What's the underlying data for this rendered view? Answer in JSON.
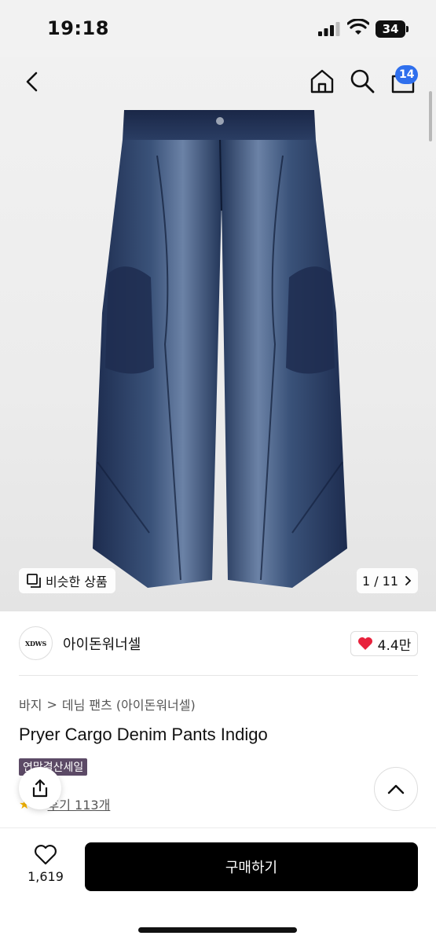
{
  "status_bar": {
    "time": "19:18",
    "battery": "34"
  },
  "header": {
    "cart_count": "14"
  },
  "gallery": {
    "similar_label": "비슷한 상품",
    "page_indicator": "1 / 11"
  },
  "brand": {
    "logo_text": "XDWS",
    "name": "아이돈워너셀",
    "likes": "4.4만"
  },
  "breadcrumb": {
    "level1": "바지",
    "separator": ">",
    "level2": "데님 팬츠 (아이돈워너셀)"
  },
  "product": {
    "title": "Pryer Cargo Denim Pants Indigo",
    "sale_tag": "연말결산세일",
    "rating_partial": "0",
    "reviews": "후기 113개"
  },
  "bottom_bar": {
    "wishlist_count": "1,619",
    "buy_label": "구매하기"
  },
  "colors": {
    "accent": "#2f6fed",
    "like": "#e8223c",
    "sale_tag": "#5c4a66",
    "buy_button": "#000000"
  },
  "icons": [
    "back-icon",
    "home-icon",
    "search-icon",
    "shopping-bag-icon",
    "similar-items-icon",
    "chevron-right-icon",
    "heart-icon",
    "share-icon",
    "chevron-up-icon",
    "star-icon"
  ]
}
